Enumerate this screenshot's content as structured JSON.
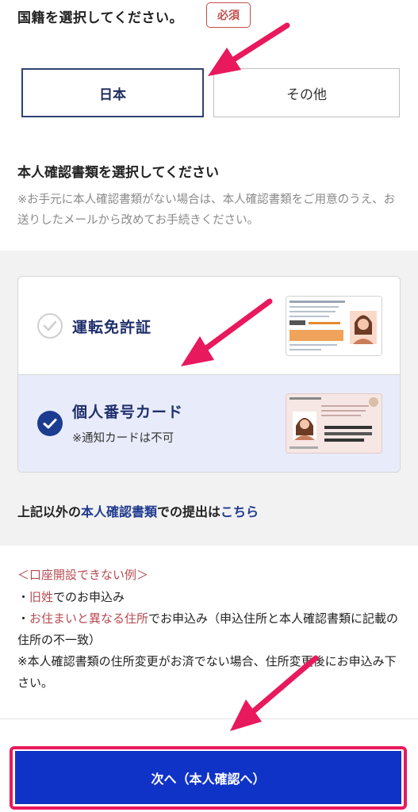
{
  "nationality": {
    "label": "国籍を選択してください。",
    "required_badge": "必須",
    "options": [
      "日本",
      "その他"
    ],
    "selected": "日本"
  },
  "document": {
    "title": "本人確認書類を選択してください",
    "note": "※お手元に本人確認書類がない場合は、本人確認書類をご用意のうえ、お送りしたメールから改めてお手続きください。",
    "options": [
      {
        "label": "運転免許証",
        "sub": ""
      },
      {
        "label": "個人番号カード",
        "sub": "※通知カードは不可"
      }
    ],
    "selected": "個人番号カード",
    "other_prefix": "上記以外の",
    "other_link1": "本人確認書類",
    "other_mid": "での提出は",
    "other_link2": "こちら"
  },
  "examples": {
    "title": "＜口座開設できない例＞",
    "line1_prefix": "・",
    "line1_em": "旧姓",
    "line1_rest": "でのお申込み",
    "line2_prefix": "・",
    "line2_em": "お住まいと異なる住所",
    "line2_rest": "でお申込み（申込住所と本人確認書類に記載の住所の不一致）",
    "line3": "※本人確認書類の住所変更がお済でない場合、住所変更後にお申込み下さい。"
  },
  "next_button": "次へ（本人確認へ）",
  "colors": {
    "accent_navy": "#1f2f6b",
    "button_blue": "#1033c7",
    "annotation_pink": "#e8195d",
    "required_red": "#c0504d"
  }
}
